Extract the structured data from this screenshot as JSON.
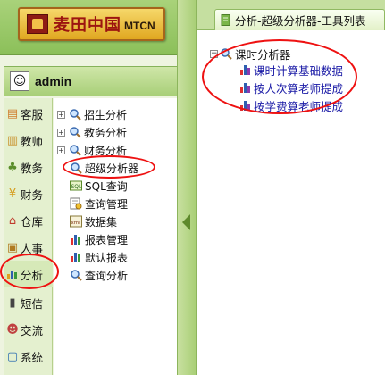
{
  "header": {
    "logo_cn": "麦田中国",
    "logo_en": "MTCN"
  },
  "user": {
    "name": "admin"
  },
  "categories": [
    {
      "label": "客服",
      "icon": "notebook-icon",
      "color": "#d07c2c"
    },
    {
      "label": "教师",
      "icon": "book-icon",
      "color": "#c9902a"
    },
    {
      "label": "教务",
      "icon": "plant-icon",
      "color": "#5a8d2a"
    },
    {
      "label": "财务",
      "icon": "money-icon",
      "color": "#d59a16"
    },
    {
      "label": "仓库",
      "icon": "house-icon",
      "color": "#c0392b"
    },
    {
      "label": "人事",
      "icon": "id-card-icon",
      "color": "#b07a20"
    },
    {
      "label": "分析",
      "icon": "chart-icon",
      "color": "#2f5fb0"
    },
    {
      "label": "短信",
      "icon": "phone-icon",
      "color": "#444444"
    },
    {
      "label": "交流",
      "icon": "people-icon",
      "color": "#c04040"
    },
    {
      "label": "系统",
      "icon": "computer-icon",
      "color": "#2b6cb0"
    }
  ],
  "tree": [
    {
      "label": "招生分析",
      "expand": "+",
      "icon": "magnifier-icon"
    },
    {
      "label": "教务分析",
      "expand": "+",
      "icon": "magnifier-icon"
    },
    {
      "label": "财务分析",
      "expand": "+",
      "icon": "magnifier-icon"
    },
    {
      "label": "超级分析器",
      "expand": "",
      "icon": "magnifier-icon"
    },
    {
      "label": "SQL查询",
      "expand": "",
      "icon": "sql-icon"
    },
    {
      "label": "查询管理",
      "expand": "",
      "icon": "query-icon"
    },
    {
      "label": "数据集",
      "expand": "",
      "icon": "xml-icon"
    },
    {
      "label": "报表管理",
      "expand": "",
      "icon": "report-icon"
    },
    {
      "label": "默认报表",
      "expand": "",
      "icon": "report-icon"
    },
    {
      "label": "查询分析",
      "expand": "",
      "icon": "magnifier-icon"
    }
  ],
  "tab": {
    "title": "分析-超级分析器-工具列表"
  },
  "tool_tree": {
    "root": "课时分析器",
    "expand": "−",
    "items": [
      {
        "label": "课时计算基础数据",
        "icon": "bar-chart-icon"
      },
      {
        "label": "按人次算老师提成",
        "icon": "bar-chart-icon"
      },
      {
        "label": "按学费算老师提成",
        "icon": "bar-chart-icon"
      }
    ]
  },
  "colors": {
    "highlight_ring": "#e11111",
    "link": "#1a1aa6",
    "accent_green": "#8cc05a"
  }
}
